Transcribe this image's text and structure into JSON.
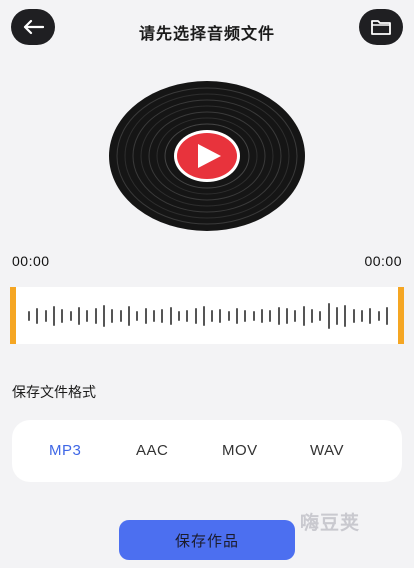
{
  "header": {
    "title": "请先选择音频文件",
    "back_icon": "arrow-left-icon",
    "folder_icon": "folder-icon"
  },
  "player": {
    "record_icon": "vinyl-record-icon",
    "play_icon": "play-icon",
    "time_start": "00:00",
    "time_end": "00:00"
  },
  "format": {
    "label": "保存文件格式",
    "options": [
      "MP3",
      "AAC",
      "MOV",
      "WAV"
    ],
    "selected": "MP3"
  },
  "save_button": {
    "label": "保存作品"
  },
  "watermark": {
    "text": "嗨豆荚"
  },
  "colors": {
    "accent": "#4c6ff0",
    "selected_text": "#3f67e6",
    "handle": "#f5a623",
    "dark_button": "#1f1f22",
    "play_red": "#e8333c"
  }
}
